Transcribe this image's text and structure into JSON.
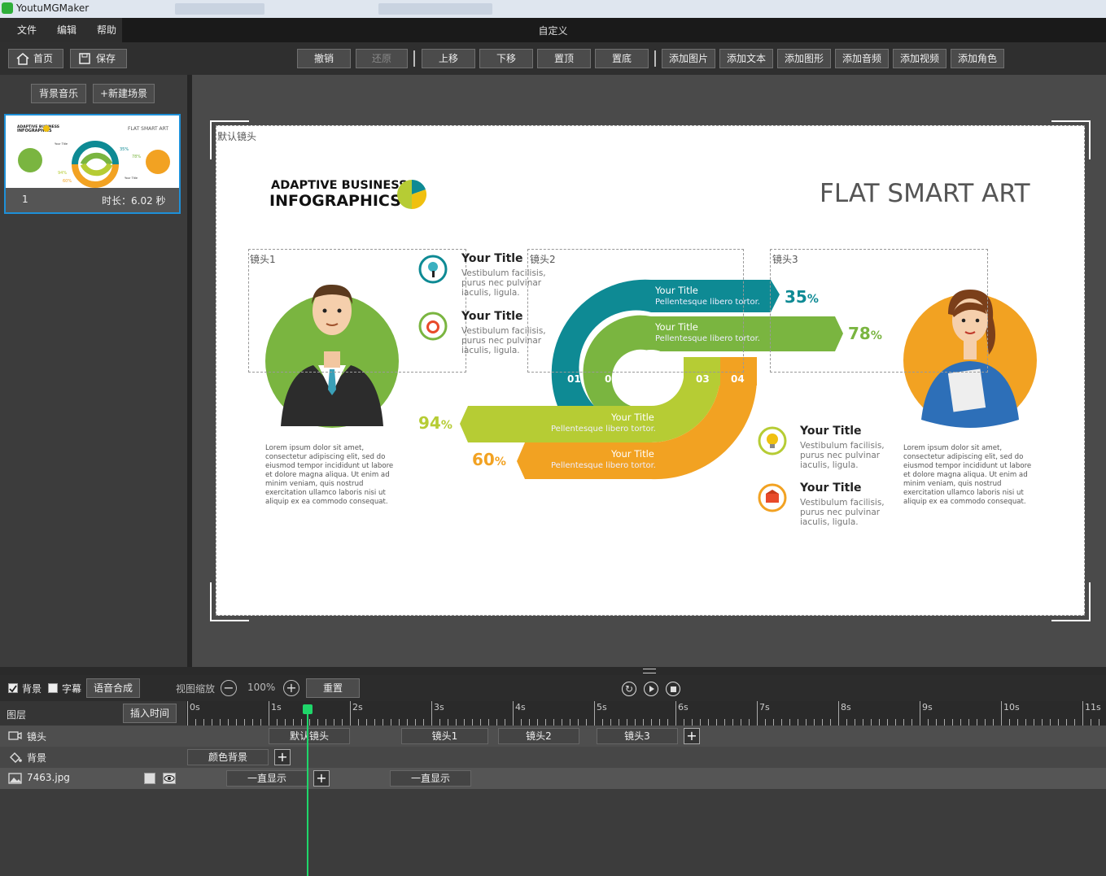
{
  "window": {
    "title": "YoutuMGMaker"
  },
  "menu": {
    "items": [
      "文件",
      "编辑",
      "帮助"
    ],
    "center_title": "自定义"
  },
  "toolbar": {
    "home": "首页",
    "save": "保存",
    "undo": "撤销",
    "redo": "还原",
    "move_up": "上移",
    "move_down": "下移",
    "to_top": "置顶",
    "to_bottom": "置底",
    "add_image": "添加图片",
    "add_text": "添加文本",
    "add_shape": "添加图形",
    "add_audio": "添加音频",
    "add_video": "添加视频",
    "add_role": "添加角色"
  },
  "scenes": {
    "bg_music": "背景音乐",
    "new_scene": "+新建场景",
    "items": [
      {
        "index": "1",
        "duration": "时长：6.02 秒"
      }
    ]
  },
  "thumb": {
    "line1": "ADAPTIVE BUSINESS",
    "line2": "INFOGRAPHICS",
    "title": "FLAT SMART ART",
    "t1": "Your Title",
    "t2": "Your Title",
    "p1": "35%",
    "p2": "78%",
    "p3": "94%",
    "p4": "60%"
  },
  "stage": {
    "default_cam": "默认镜头",
    "cam1": "镜头1",
    "cam2": "镜头2",
    "cam3": "镜头3",
    "brand_line1": "ADAPTIVE BUSINESS",
    "brand_line2": "INFOGRAPHICS",
    "main_title": "FLAT SMART ART",
    "lorem": "Lorem ipsum dolor sit amet, consectetur adipiscing elit, sed do eiusmod tempor incididunt ut labore et dolore magna aliqua. Ut enim ad minim veniam, quis nostrud exercitation ullamco laboris nisi ut aliquip ex ea commodo consequat.",
    "titles": [
      {
        "title": "Your Title",
        "text": "Vestibulum facilisis, purus nec pulvinar iaculis, ligula."
      },
      {
        "title": "Your Title",
        "text": "Vestibulum facilisis, purus nec pulvinar iaculis, ligula."
      },
      {
        "title": "Your Title",
        "text": "Vestibulum facilisis, purus nec pulvinar iaculis, ligula."
      },
      {
        "title": "Your Title",
        "text": "Vestibulum facilisis, purus nec pulvinar iaculis, ligula."
      }
    ],
    "bands": [
      {
        "title": "Your Title",
        "text": "Pellentesque libero tortor.",
        "pct": "35",
        "color": "#0e8a94"
      },
      {
        "title": "Your Title",
        "text": "Pellentesque libero tortor.",
        "pct": "78",
        "color": "#7ab540"
      },
      {
        "title": "Your Title",
        "text": "Pellentesque libero tortor.",
        "pct": "94",
        "color": "#b6cc34"
      },
      {
        "title": "Your Title",
        "text": "Pellentesque libero tortor.",
        "pct": "60",
        "color": "#f2a222"
      }
    ],
    "pct_sign": "%",
    "nums": [
      "01",
      "02",
      "03",
      "04"
    ]
  },
  "controls": {
    "bg_label": "背景",
    "subtitle_label": "字幕",
    "tts": "语音合成",
    "zoom_label": "视图缩放",
    "zoom": "100%",
    "reset": "重置"
  },
  "timeline": {
    "layers_label": "图层",
    "insert_time": "插入时间",
    "ticks": [
      "0s",
      "1s",
      "2s",
      "3s",
      "4s",
      "5s",
      "6s",
      "7s",
      "8s",
      "9s",
      "10s",
      "11s"
    ],
    "rows": [
      {
        "name": "镜头",
        "clips": [
          "默认镜头",
          "镜头1",
          "镜头2",
          "镜头3"
        ]
      },
      {
        "name": "背景",
        "clips": [
          "颜色背景"
        ]
      },
      {
        "name": "7463.jpg",
        "clips": [
          "一直显示",
          "一直显示"
        ]
      }
    ]
  }
}
